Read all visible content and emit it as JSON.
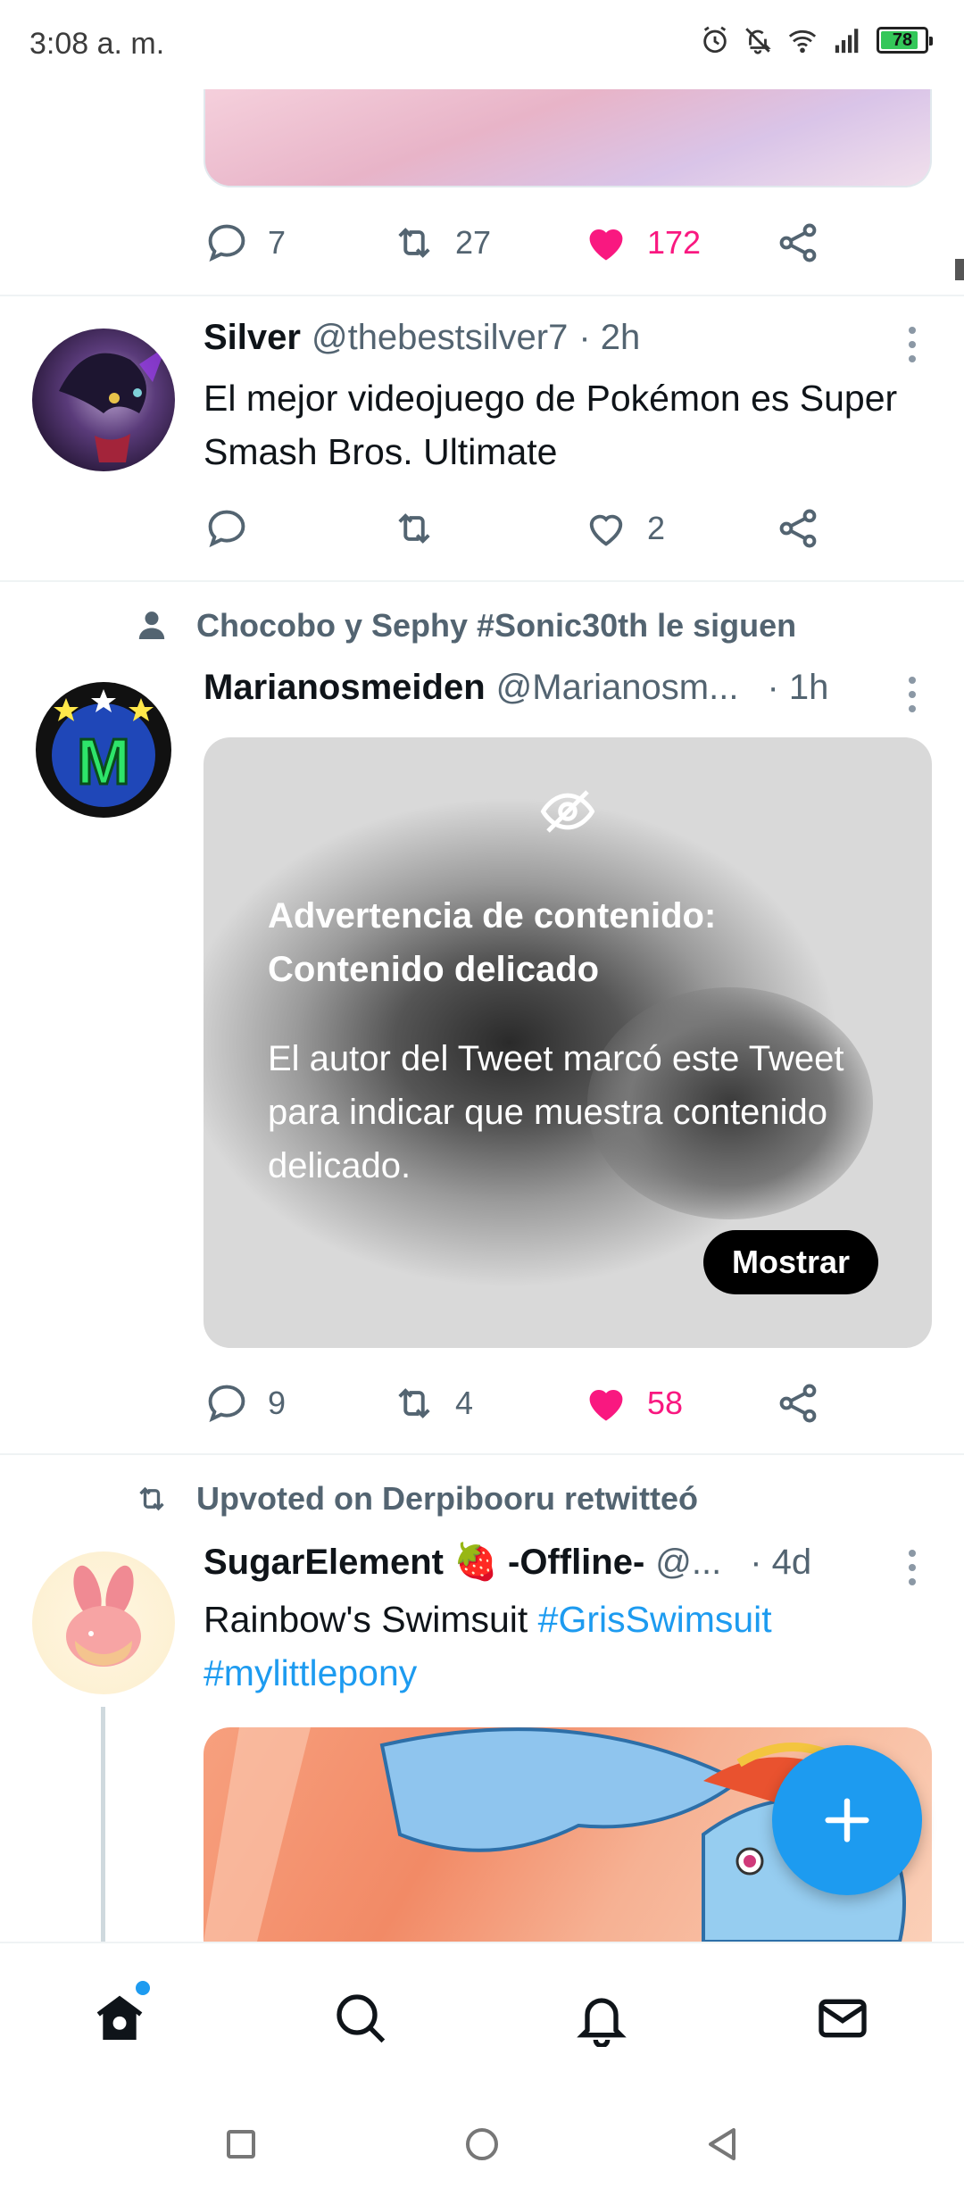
{
  "status_bar": {
    "time": "3:08 a. m.",
    "battery_level": "78"
  },
  "feed": {
    "tweet0": {
      "reply_count": "7",
      "retweet_count": "27",
      "like_count": "172"
    },
    "tweet1": {
      "display_name": "Silver",
      "handle": "@thebestsilver7",
      "time": "· 2h",
      "text": "El mejor videojuego de Pokémon es Super Smash Bros. Ultimate",
      "reply_count": "",
      "retweet_count": "",
      "like_count": "2"
    },
    "tweet2": {
      "social_context": "Chocobo y Sephy #Sonic30th le siguen",
      "display_name": "Marianosmeiden",
      "handle": "@Marianosm...",
      "time": "· 1h",
      "warning_title": "Advertencia de contenido: Contenido delicado",
      "warning_body": "El autor del Tweet marcó este Tweet para indicar que muestra contenido delicado.",
      "show_button": "Mostrar",
      "reply_count": "9",
      "retweet_count": "4",
      "like_count": "58"
    },
    "tweet3": {
      "retweet_context": "Upvoted on Derpibooru retwitteó",
      "display_name": "SugarElement 🍓 -Offline-",
      "handle": "@...",
      "time": "· 4d",
      "text_plain": "Rainbow's Swimsuit ",
      "hashtag1": "#GrisSwimsuit",
      "hashtag2": "#mylittlepony"
    }
  },
  "colors": {
    "accent": "#1d9bf0",
    "like": "#f91880",
    "secondary_text": "#536471"
  },
  "bottom_nav": [
    "home-icon",
    "search-icon",
    "bell-icon",
    "mail-icon"
  ],
  "system_nav": [
    "recents-square-icon",
    "home-circle-icon",
    "back-triangle-icon"
  ]
}
